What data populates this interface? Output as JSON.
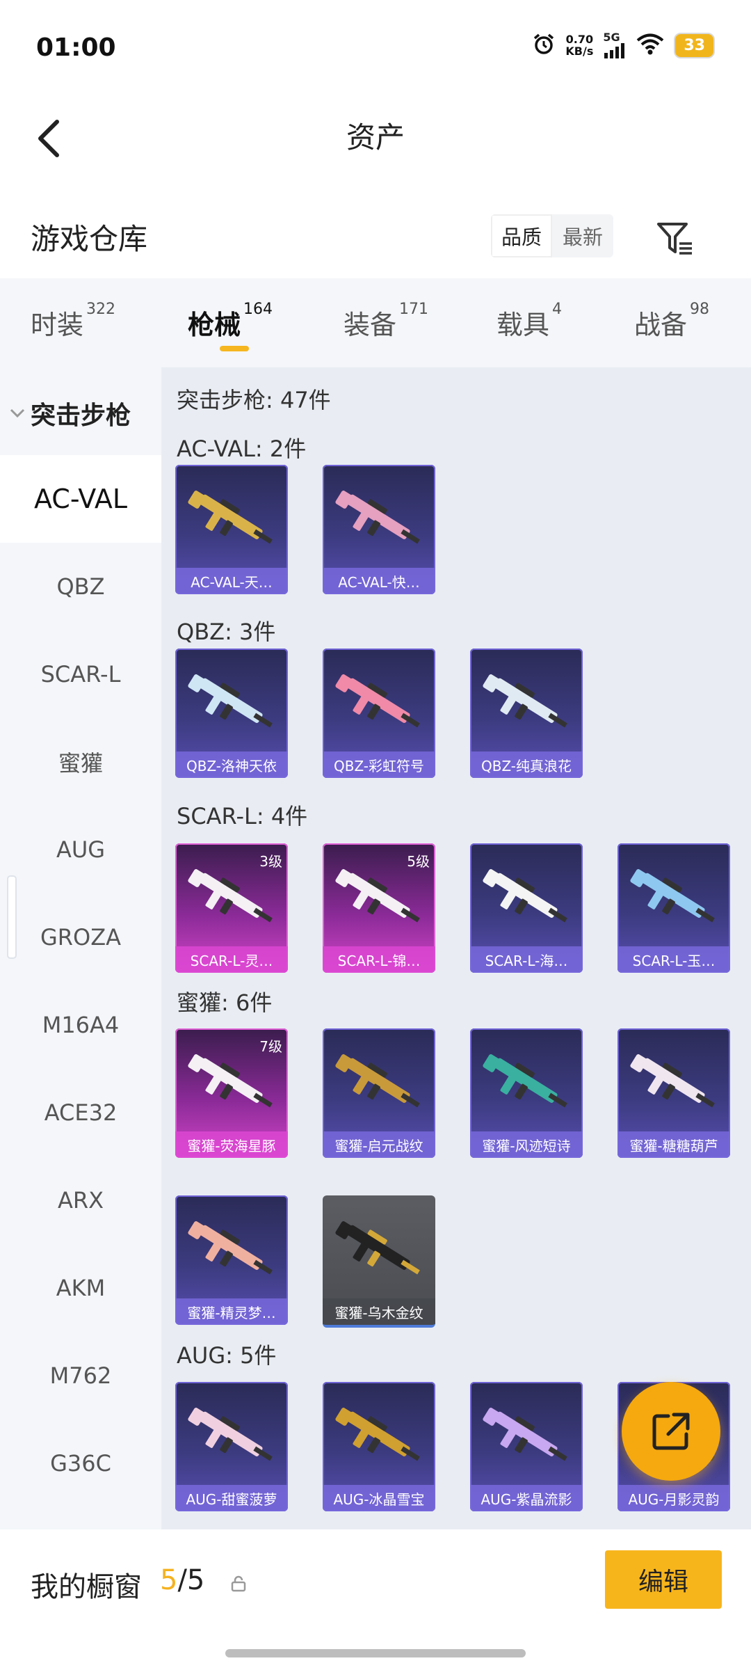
{
  "status": {
    "time": "01:00",
    "net_speed_value": "0.70",
    "net_speed_unit": "KB/s",
    "network": "5G",
    "battery": "33"
  },
  "header": {
    "title": "资产"
  },
  "section": {
    "title": "游戏仓库",
    "sort_options": [
      "品质",
      "最新"
    ],
    "active_sort": "品质"
  },
  "tabs": [
    {
      "label": "时装",
      "count": "322"
    },
    {
      "label": "枪械",
      "count": "164",
      "active": true
    },
    {
      "label": "装备",
      "count": "171"
    },
    {
      "label": "载具",
      "count": "4"
    },
    {
      "label": "战备",
      "count": "98"
    }
  ],
  "sidebar": {
    "group": "突击步枪",
    "items": [
      "AC-VAL",
      "QBZ",
      "SCAR-L",
      "蜜獾",
      "AUG",
      "GROZA",
      "M16A4",
      "ACE32",
      "ARX",
      "AKM",
      "M762",
      "G36C"
    ],
    "active_item": "AC-VAL"
  },
  "content": {
    "category_heading": "突击步枪: 47件",
    "groups": [
      {
        "label": "AC-VAL: 2件",
        "items": [
          {
            "name": "AC-VAL-天…",
            "style": "blue",
            "level": ""
          },
          {
            "name": "AC-VAL-快…",
            "style": "blue",
            "level": ""
          }
        ]
      },
      {
        "label": "QBZ: 3件",
        "items": [
          {
            "name": "QBZ-洛神天依",
            "style": "blue",
            "level": ""
          },
          {
            "name": "QBZ-彩虹符号",
            "style": "blue",
            "level": ""
          },
          {
            "name": "QBZ-纯真浪花",
            "style": "blue",
            "level": ""
          }
        ]
      },
      {
        "label": "SCAR-L: 4件",
        "items": [
          {
            "name": "SCAR-L-灵…",
            "style": "pink",
            "level": "3级"
          },
          {
            "name": "SCAR-L-锦…",
            "style": "pink",
            "level": "5级"
          },
          {
            "name": "SCAR-L-海…",
            "style": "blue",
            "level": ""
          },
          {
            "name": "SCAR-L-玉…",
            "style": "blue",
            "level": ""
          }
        ]
      },
      {
        "label": "蜜獾: 6件",
        "items": [
          {
            "name": "蜜獾-荧海星豚",
            "style": "pink",
            "level": "7级"
          },
          {
            "name": "蜜獾-启元战纹",
            "style": "blue",
            "level": ""
          },
          {
            "name": "蜜獾-风迹短诗",
            "style": "blue",
            "level": ""
          },
          {
            "name": "蜜獾-糖糖葫芦",
            "style": "blue",
            "level": ""
          },
          {
            "name": "蜜獾-精灵梦…",
            "style": "blue",
            "level": ""
          },
          {
            "name": "蜜獾-乌木金纹",
            "style": "grey",
            "level": ""
          }
        ]
      },
      {
        "label": "AUG: 5件",
        "items": [
          {
            "name": "AUG-甜蜜菠萝",
            "style": "blue",
            "level": ""
          },
          {
            "name": "AUG-冰晶雪宝",
            "style": "blue",
            "level": ""
          },
          {
            "name": "AUG-紫晶流影",
            "style": "blue",
            "level": ""
          },
          {
            "name": "AUG-月影灵韵",
            "style": "blue",
            "level": ""
          }
        ]
      }
    ]
  },
  "bottom": {
    "window_label": "我的橱窗",
    "window_current": "5",
    "window_total": "/5",
    "edit_label": "编辑"
  },
  "icons": {
    "back": "back-arrow-icon",
    "filter": "filter-icon",
    "share": "share-external-icon",
    "lock": "lock-icon",
    "alarm": "alarm-icon",
    "wifi": "wifi-icon",
    "signal": "signal-icon"
  }
}
